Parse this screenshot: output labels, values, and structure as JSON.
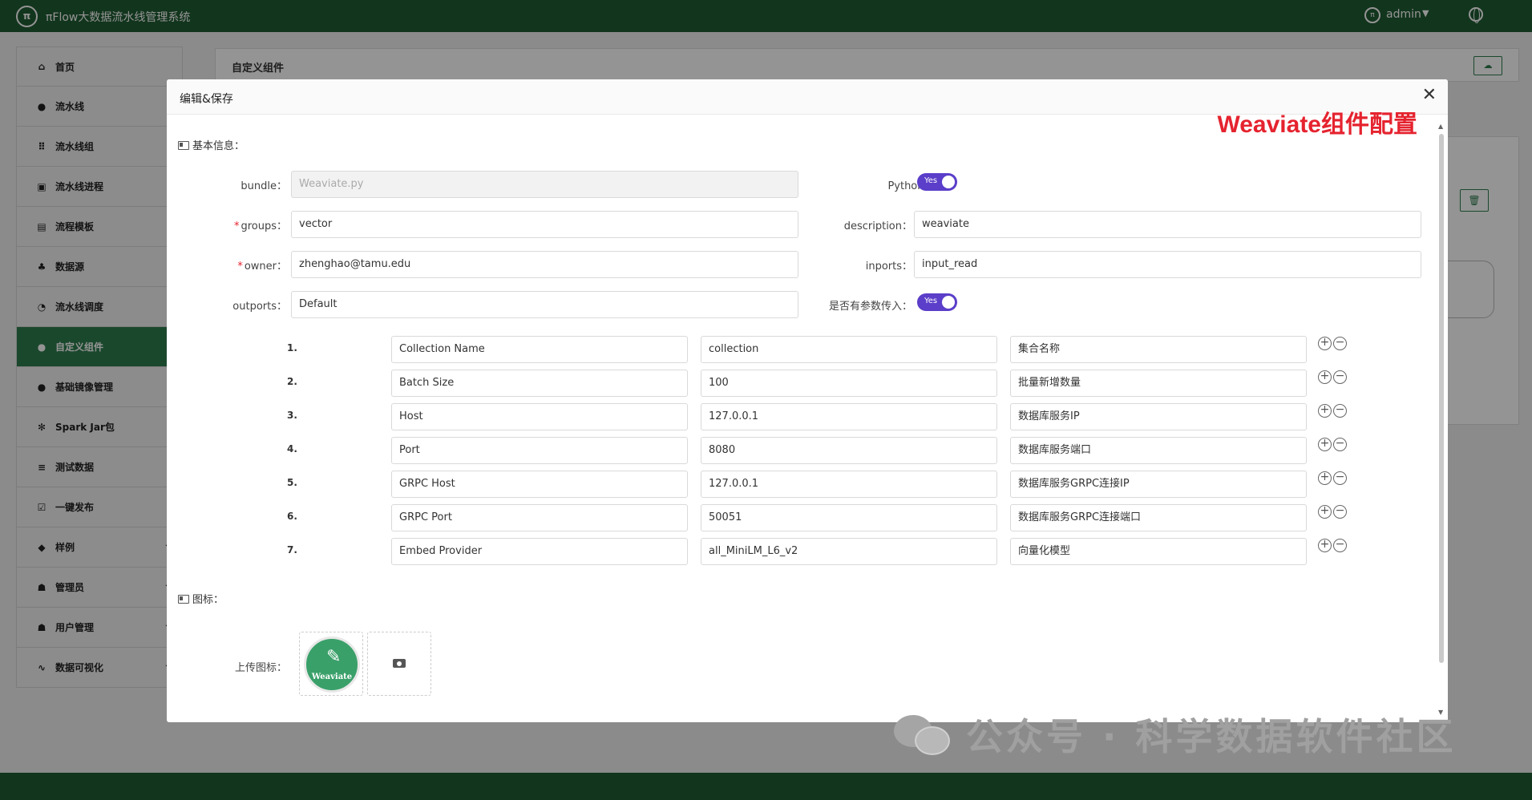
{
  "app": {
    "title": "πFlow大数据流水线管理系统",
    "user": "admin",
    "logo_text": "π"
  },
  "sidebar": {
    "items": [
      {
        "label": "首页",
        "icon": "home-icon",
        "glyph": "⌂",
        "has_children": false,
        "active": false
      },
      {
        "label": "流水线",
        "icon": "pipeline-icon",
        "glyph": "●",
        "has_children": false,
        "active": false
      },
      {
        "label": "流水线组",
        "icon": "grid-icon",
        "glyph": "⠿",
        "has_children": false,
        "active": false
      },
      {
        "label": "流水线进程",
        "icon": "chart-icon",
        "glyph": "▣",
        "has_children": false,
        "active": false
      },
      {
        "label": "流程模板",
        "icon": "template-icon",
        "glyph": "▤",
        "has_children": false,
        "active": false
      },
      {
        "label": "数据源",
        "icon": "database-icon",
        "glyph": "♣",
        "has_children": false,
        "active": false
      },
      {
        "label": "流水线调度",
        "icon": "clock-icon",
        "glyph": "◔",
        "has_children": false,
        "active": false
      },
      {
        "label": "自定义组件",
        "icon": "component-icon",
        "glyph": "●",
        "has_children": false,
        "active": true
      },
      {
        "label": "基础镜像管理",
        "icon": "image-icon",
        "glyph": "●",
        "has_children": false,
        "active": false
      },
      {
        "label": "Spark Jar包",
        "icon": "gear-icon",
        "glyph": "✻",
        "has_children": false,
        "active": false
      },
      {
        "label": "测试数据",
        "icon": "list-icon",
        "glyph": "≡",
        "has_children": false,
        "active": false
      },
      {
        "label": "一键发布",
        "icon": "checkbox-icon",
        "glyph": "☑",
        "has_children": false,
        "active": false
      },
      {
        "label": "样例",
        "icon": "cube-icon",
        "glyph": "◆",
        "has_children": true,
        "active": false
      },
      {
        "label": "管理员",
        "icon": "users-icon",
        "glyph": "☗",
        "has_children": true,
        "active": false
      },
      {
        "label": "用户管理",
        "icon": "users-icon",
        "glyph": "☗",
        "has_children": true,
        "active": false
      },
      {
        "label": "数据可视化",
        "icon": "pulse-icon",
        "glyph": "∿",
        "has_children": true,
        "active": false
      }
    ]
  },
  "content": {
    "header_title": "自定义组件"
  },
  "modal": {
    "title": "编辑&保存",
    "annotation": "Weaviate组件配置",
    "basic_section": "基本信息：",
    "icon_section": "图标：",
    "fields": {
      "bundle_label": "bundle：",
      "bundle_value": "Weaviate.py",
      "python_label": "Python组件：：",
      "python_toggle": "Yes",
      "groups_label": "groups：",
      "groups_value": "vector",
      "description_label": "description：",
      "description_value": "weaviate",
      "owner_label": "owner：",
      "owner_value": "zhenghao@tamu.edu",
      "inports_label": "inports：",
      "inports_value": "input_read",
      "outports_label": "outports：",
      "outports_value": "Default",
      "params_label": "是否有参数传入：",
      "params_toggle": "Yes"
    },
    "params": [
      {
        "num": "1.",
        "name": "Collection Name",
        "value": "collection",
        "desc": "集合名称"
      },
      {
        "num": "2.",
        "name": "Batch Size",
        "value": "100",
        "desc": "批量新增数量"
      },
      {
        "num": "3.",
        "name": "Host",
        "value": "127.0.0.1",
        "desc": "数据库服务IP"
      },
      {
        "num": "4.",
        "name": "Port",
        "value": "8080",
        "desc": "数据库服务端口"
      },
      {
        "num": "5.",
        "name": "GRPC Host",
        "value": "127.0.0.1",
        "desc": "数据库服务GRPC连接IP"
      },
      {
        "num": "6.",
        "name": "GRPC Port",
        "value": "50051",
        "desc": "数据库服务GRPC连接端口"
      },
      {
        "num": "7.",
        "name": "Embed Provider",
        "value": "all_MiniLM_L6_v2",
        "desc": "向量化模型"
      }
    ],
    "upload_label": "上传图标：",
    "icon_name": "Weaviate"
  },
  "watermark": {
    "text": "公众号 · 科学数据软件社区"
  },
  "colors": {
    "primary": "#1f5c33",
    "active": "#2e7d4f",
    "toggle": "#5b3ec9",
    "annotation": "#e5232f"
  }
}
